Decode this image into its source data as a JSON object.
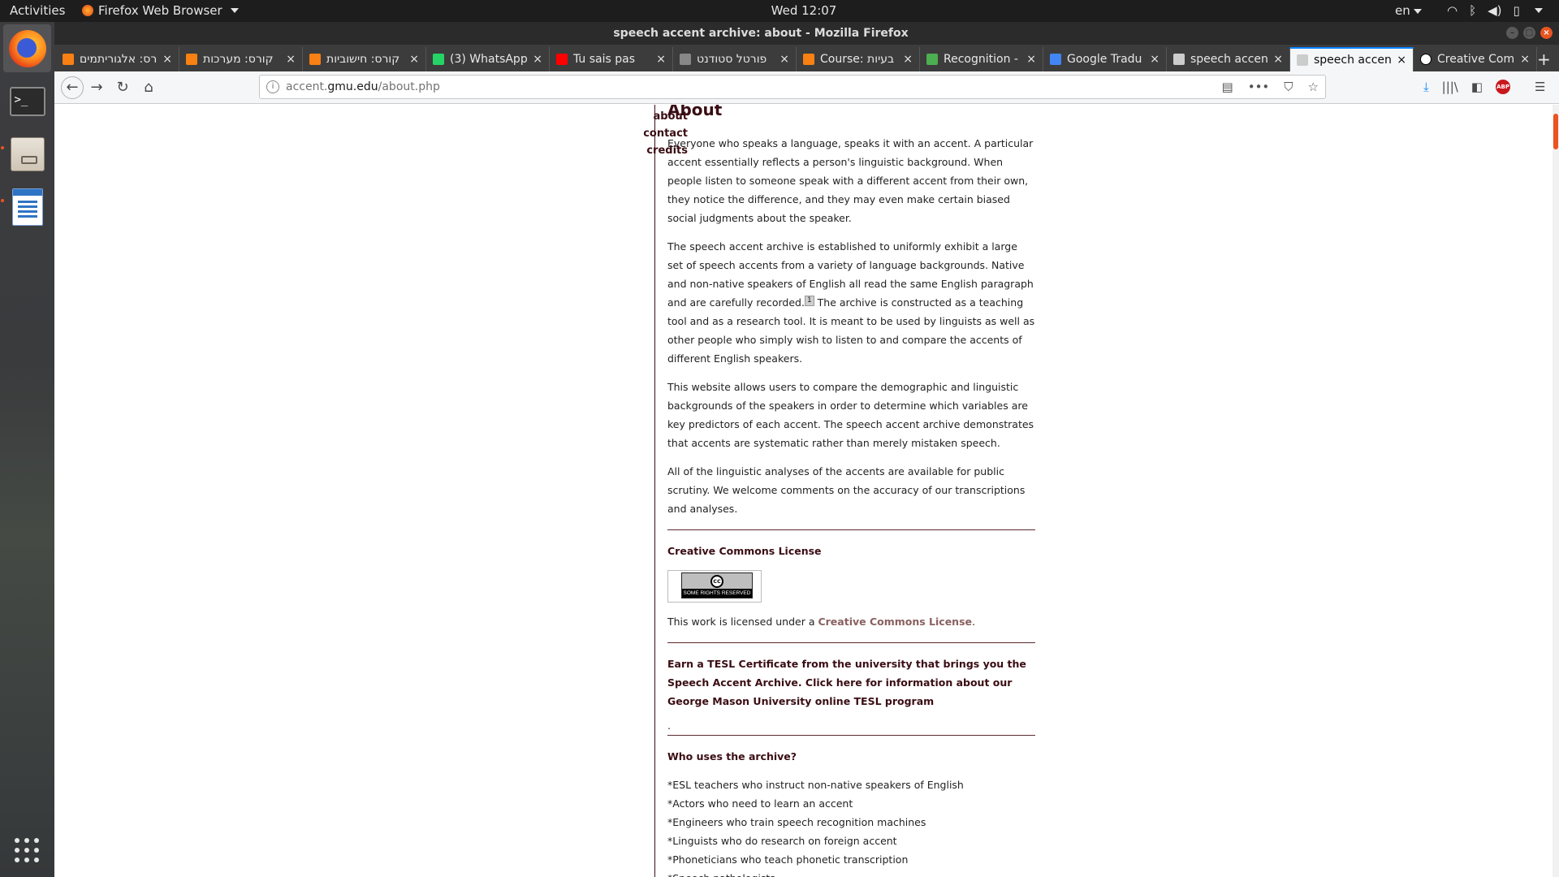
{
  "topbar": {
    "activities": "Activities",
    "app_menu": "Firefox Web Browser",
    "clock": "Wed 12:07",
    "lang": "en"
  },
  "window": {
    "title": "speech accent archive: about - Mozilla Firefox"
  },
  "tabs": [
    {
      "label": "קורס: אלגוריתמים",
      "favicon": "moodle-icon",
      "color": "#f98012"
    },
    {
      "label": "קורס: מערכות",
      "favicon": "moodle-icon",
      "color": "#f98012"
    },
    {
      "label": "קורס: חישוביות",
      "favicon": "moodle-icon",
      "color": "#f98012"
    },
    {
      "label": "(3) WhatsApp",
      "favicon": "whatsapp-icon",
      "color": "#25d366"
    },
    {
      "label": "Tu sais pas",
      "favicon": "youtube-icon",
      "color": "#ff0000"
    },
    {
      "label": "פורטל סטודנט",
      "favicon": "portal-icon",
      "color": "#888888"
    },
    {
      "label": "Course: בעיות",
      "favicon": "moodle-icon",
      "color": "#f98012"
    },
    {
      "label": "Recognition -",
      "favicon": "leaf-icon",
      "color": "#4caf50"
    },
    {
      "label": "Google Tradu",
      "favicon": "google-translate-icon",
      "color": "#4285f4"
    },
    {
      "label": "speech accen",
      "favicon": "globe-icon",
      "color": "#cccccc"
    },
    {
      "label": "speech accen",
      "favicon": "globe-icon",
      "color": "#cccccc",
      "selected": true
    },
    {
      "label": "Creative Com",
      "favicon": "cc-icon",
      "color": "#ffffff"
    }
  ],
  "url": {
    "prefix": "accent.",
    "domain": "gmu.edu",
    "path": "/about.php"
  },
  "sidebar_nav": {
    "about": "about",
    "contact": "contact",
    "credits": "credits"
  },
  "content": {
    "heading": "About",
    "p1": "Everyone who speaks a language, speaks it with an accent. A particular accent essentially reflects a person's linguistic background. When people listen to someone speak with a different accent from their own, they notice the difference, and they may even make certain biased social judgments about the speaker.",
    "p2a": "The speech accent archive is established to uniformly exhibit a large set of speech accents from a variety of language backgrounds. Native and non-native speakers of English all read the same English paragraph and are carefully recorded.",
    "footnote": "1",
    "p2b": " The archive is constructed as a teaching tool and as a research tool. It is meant to be used by linguists as well as other people who simply wish to listen to and compare the accents of different English speakers.",
    "p3": "This website allows users to compare the demographic and linguistic backgrounds of the speakers in order to determine which variables are key predictors of each accent. The speech accent archive demonstrates that accents are systematic rather than merely mistaken speech.",
    "p4": "All of the linguistic analyses of the accents are available for public scrutiny. We welcome comments on the accuracy of our transcriptions and analyses.",
    "cc_heading": "Creative Commons License",
    "cc_badge_text": "SOME RIGHTS RESERVED",
    "cc_badge_symbol": "cc",
    "license_text": "This work is licensed under a ",
    "license_link": "Creative Commons License",
    "license_end": ".",
    "promo": "Earn a TESL Certificate from the university that brings you the Speech Accent Archive. Click here for information about our George Mason University online TESL program",
    "promo_dot": ".",
    "who_heading": "Who uses the archive?",
    "uses": [
      "*ESL teachers who instruct non-native speakers of English",
      "*Actors who need to learn an accent",
      "*Engineers who train speech recognition machines",
      "*Linguists who do research on foreign accent",
      "*Phoneticians who teach phonetic transcription",
      "*Speech pathologists"
    ]
  },
  "colors": {
    "brand_maroon": "#3a0d13",
    "ubuntu_orange": "#e95420",
    "firefox_blue": "#0a84ff"
  }
}
